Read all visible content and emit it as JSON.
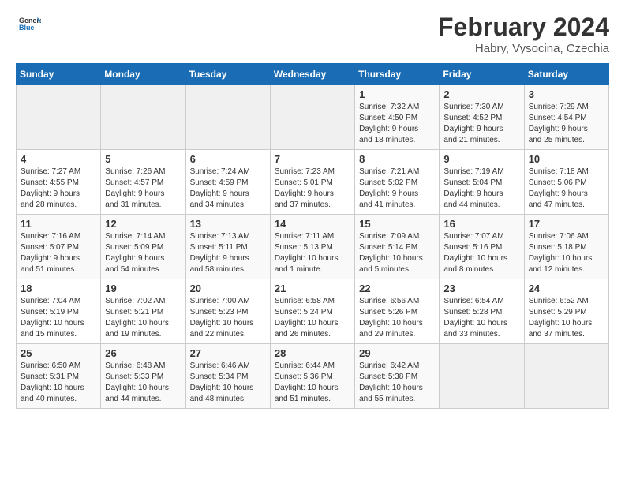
{
  "logo": {
    "text_general": "General",
    "text_blue": "Blue"
  },
  "title": "February 2024",
  "subtitle": "Habry, Vysocina, Czechia",
  "weekdays": [
    "Sunday",
    "Monday",
    "Tuesday",
    "Wednesday",
    "Thursday",
    "Friday",
    "Saturday"
  ],
  "weeks": [
    [
      {
        "day": "",
        "info": ""
      },
      {
        "day": "",
        "info": ""
      },
      {
        "day": "",
        "info": ""
      },
      {
        "day": "",
        "info": ""
      },
      {
        "day": "1",
        "info": "Sunrise: 7:32 AM\nSunset: 4:50 PM\nDaylight: 9 hours\nand 18 minutes."
      },
      {
        "day": "2",
        "info": "Sunrise: 7:30 AM\nSunset: 4:52 PM\nDaylight: 9 hours\nand 21 minutes."
      },
      {
        "day": "3",
        "info": "Sunrise: 7:29 AM\nSunset: 4:54 PM\nDaylight: 9 hours\nand 25 minutes."
      }
    ],
    [
      {
        "day": "4",
        "info": "Sunrise: 7:27 AM\nSunset: 4:55 PM\nDaylight: 9 hours\nand 28 minutes."
      },
      {
        "day": "5",
        "info": "Sunrise: 7:26 AM\nSunset: 4:57 PM\nDaylight: 9 hours\nand 31 minutes."
      },
      {
        "day": "6",
        "info": "Sunrise: 7:24 AM\nSunset: 4:59 PM\nDaylight: 9 hours\nand 34 minutes."
      },
      {
        "day": "7",
        "info": "Sunrise: 7:23 AM\nSunset: 5:01 PM\nDaylight: 9 hours\nand 37 minutes."
      },
      {
        "day": "8",
        "info": "Sunrise: 7:21 AM\nSunset: 5:02 PM\nDaylight: 9 hours\nand 41 minutes."
      },
      {
        "day": "9",
        "info": "Sunrise: 7:19 AM\nSunset: 5:04 PM\nDaylight: 9 hours\nand 44 minutes."
      },
      {
        "day": "10",
        "info": "Sunrise: 7:18 AM\nSunset: 5:06 PM\nDaylight: 9 hours\nand 47 minutes."
      }
    ],
    [
      {
        "day": "11",
        "info": "Sunrise: 7:16 AM\nSunset: 5:07 PM\nDaylight: 9 hours\nand 51 minutes."
      },
      {
        "day": "12",
        "info": "Sunrise: 7:14 AM\nSunset: 5:09 PM\nDaylight: 9 hours\nand 54 minutes."
      },
      {
        "day": "13",
        "info": "Sunrise: 7:13 AM\nSunset: 5:11 PM\nDaylight: 9 hours\nand 58 minutes."
      },
      {
        "day": "14",
        "info": "Sunrise: 7:11 AM\nSunset: 5:13 PM\nDaylight: 10 hours\nand 1 minute."
      },
      {
        "day": "15",
        "info": "Sunrise: 7:09 AM\nSunset: 5:14 PM\nDaylight: 10 hours\nand 5 minutes."
      },
      {
        "day": "16",
        "info": "Sunrise: 7:07 AM\nSunset: 5:16 PM\nDaylight: 10 hours\nand 8 minutes."
      },
      {
        "day": "17",
        "info": "Sunrise: 7:06 AM\nSunset: 5:18 PM\nDaylight: 10 hours\nand 12 minutes."
      }
    ],
    [
      {
        "day": "18",
        "info": "Sunrise: 7:04 AM\nSunset: 5:19 PM\nDaylight: 10 hours\nand 15 minutes."
      },
      {
        "day": "19",
        "info": "Sunrise: 7:02 AM\nSunset: 5:21 PM\nDaylight: 10 hours\nand 19 minutes."
      },
      {
        "day": "20",
        "info": "Sunrise: 7:00 AM\nSunset: 5:23 PM\nDaylight: 10 hours\nand 22 minutes."
      },
      {
        "day": "21",
        "info": "Sunrise: 6:58 AM\nSunset: 5:24 PM\nDaylight: 10 hours\nand 26 minutes."
      },
      {
        "day": "22",
        "info": "Sunrise: 6:56 AM\nSunset: 5:26 PM\nDaylight: 10 hours\nand 29 minutes."
      },
      {
        "day": "23",
        "info": "Sunrise: 6:54 AM\nSunset: 5:28 PM\nDaylight: 10 hours\nand 33 minutes."
      },
      {
        "day": "24",
        "info": "Sunrise: 6:52 AM\nSunset: 5:29 PM\nDaylight: 10 hours\nand 37 minutes."
      }
    ],
    [
      {
        "day": "25",
        "info": "Sunrise: 6:50 AM\nSunset: 5:31 PM\nDaylight: 10 hours\nand 40 minutes."
      },
      {
        "day": "26",
        "info": "Sunrise: 6:48 AM\nSunset: 5:33 PM\nDaylight: 10 hours\nand 44 minutes."
      },
      {
        "day": "27",
        "info": "Sunrise: 6:46 AM\nSunset: 5:34 PM\nDaylight: 10 hours\nand 48 minutes."
      },
      {
        "day": "28",
        "info": "Sunrise: 6:44 AM\nSunset: 5:36 PM\nDaylight: 10 hours\nand 51 minutes."
      },
      {
        "day": "29",
        "info": "Sunrise: 6:42 AM\nSunset: 5:38 PM\nDaylight: 10 hours\nand 55 minutes."
      },
      {
        "day": "",
        "info": ""
      },
      {
        "day": "",
        "info": ""
      }
    ]
  ]
}
